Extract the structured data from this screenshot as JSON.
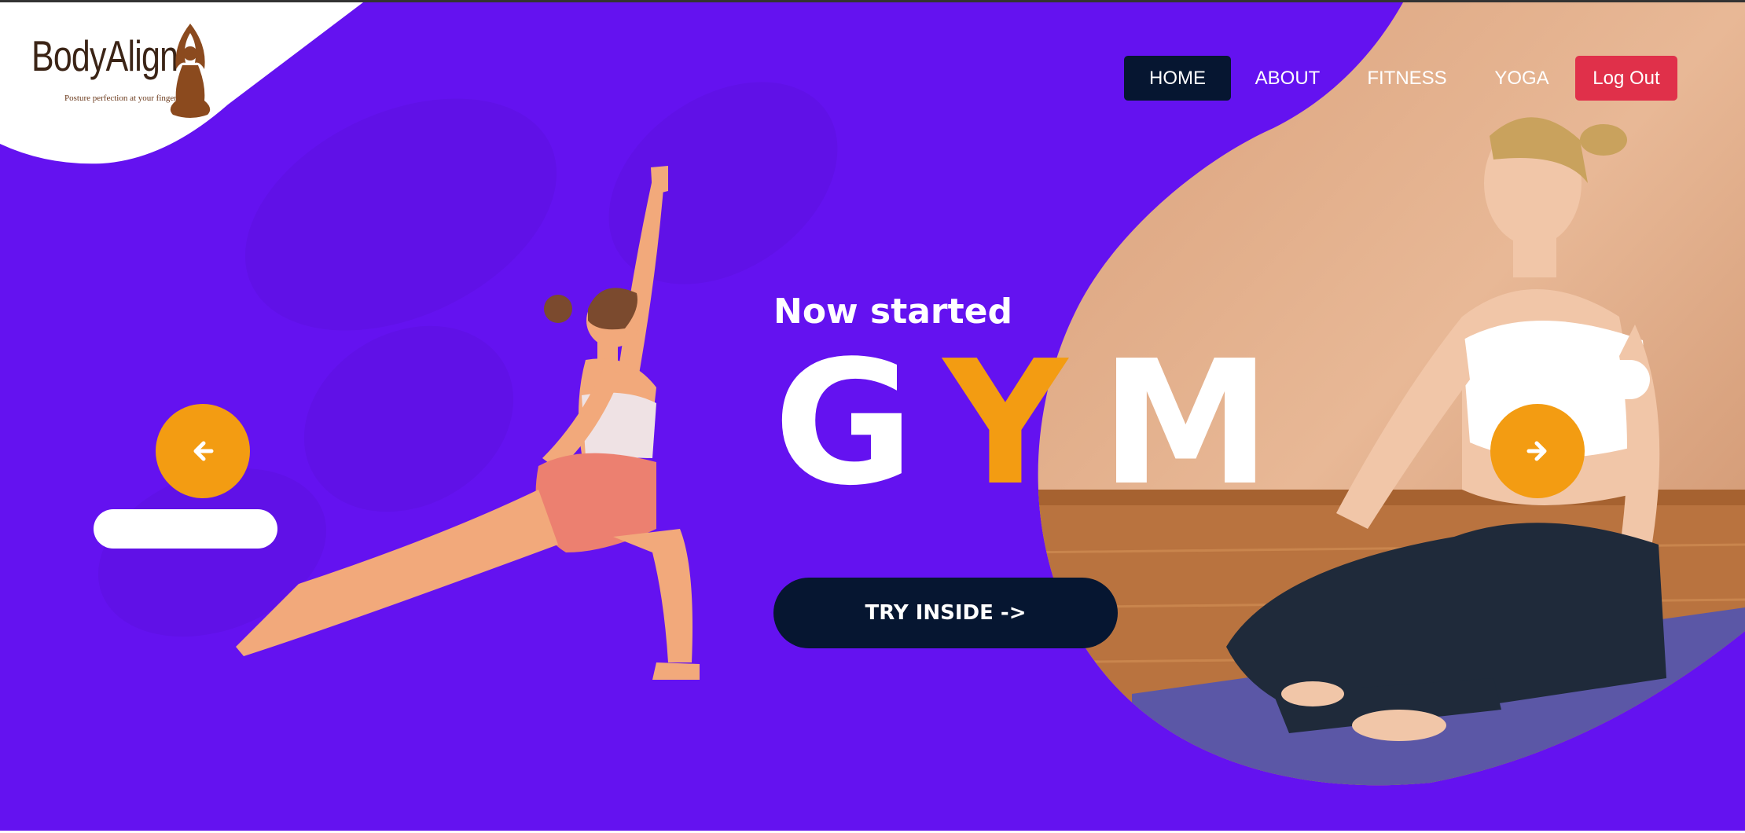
{
  "logo": {
    "name": "BodyAlign",
    "tagline": "Posture perfection at your fingertips"
  },
  "nav": {
    "home": "HOME",
    "about": "ABOUT",
    "fitness": "FITNESS",
    "yoga": "YOGA",
    "logout": "Log Out"
  },
  "hero": {
    "subtitle": "Now started",
    "letters": [
      "G",
      "Y",
      "M"
    ],
    "cta": "TRY INSIDE ->"
  },
  "icons": {
    "prev": "arrow-left-icon",
    "next": "arrow-right-icon"
  },
  "colors": {
    "hero_bg": "#6412f0",
    "accent": "#f39c12",
    "nav_active": "#061631",
    "logout": "#e0304a"
  }
}
